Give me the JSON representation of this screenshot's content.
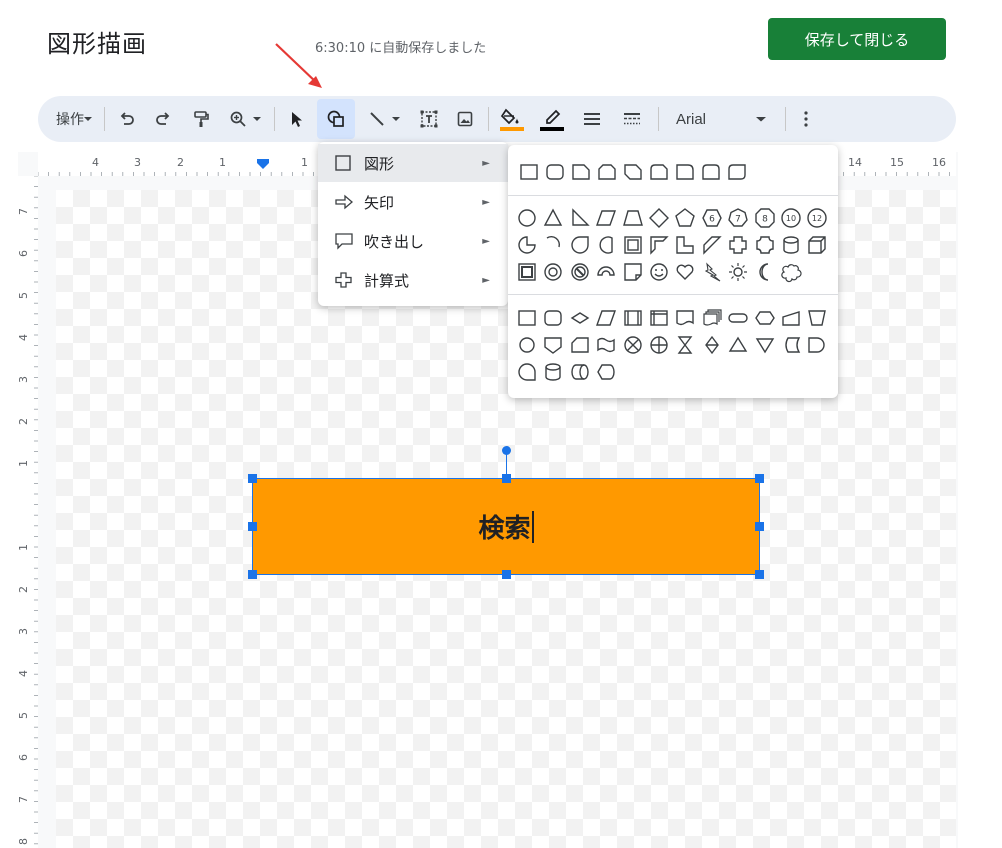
{
  "header": {
    "title": "図形描画",
    "autosave": "6:30:10 に自動保存しました",
    "save_close": "保存して閉じる"
  },
  "toolbar": {
    "actions_label": "操作",
    "font_name": "Arial",
    "fill_color": "#ff9900",
    "line_color": "#000000",
    "active_tool": "shape-tool"
  },
  "ruler": {
    "top_left_numbers": [
      "4",
      "3",
      "2",
      "1",
      "1"
    ],
    "top_right_numbers": [
      "14",
      "15",
      "16"
    ],
    "left_numbers": [
      "7",
      "6",
      "5",
      "4",
      "3",
      "2",
      "1",
      "1",
      "2",
      "3",
      "4",
      "5",
      "6",
      "7",
      "8"
    ]
  },
  "menu": {
    "items": [
      {
        "label": "図形",
        "icon": "square-outline-icon"
      },
      {
        "label": "矢印",
        "icon": "arrow-outline-icon"
      },
      {
        "label": "吹き出し",
        "icon": "callout-icon"
      },
      {
        "label": "計算式",
        "icon": "plus-outline-icon"
      }
    ]
  },
  "canvas": {
    "shape_text": "検索",
    "shape_fill": "#ff9900"
  },
  "colors": {
    "accent": "#1a73e8",
    "save_button": "#188038",
    "toolbar_bg": "#e9eef6"
  }
}
